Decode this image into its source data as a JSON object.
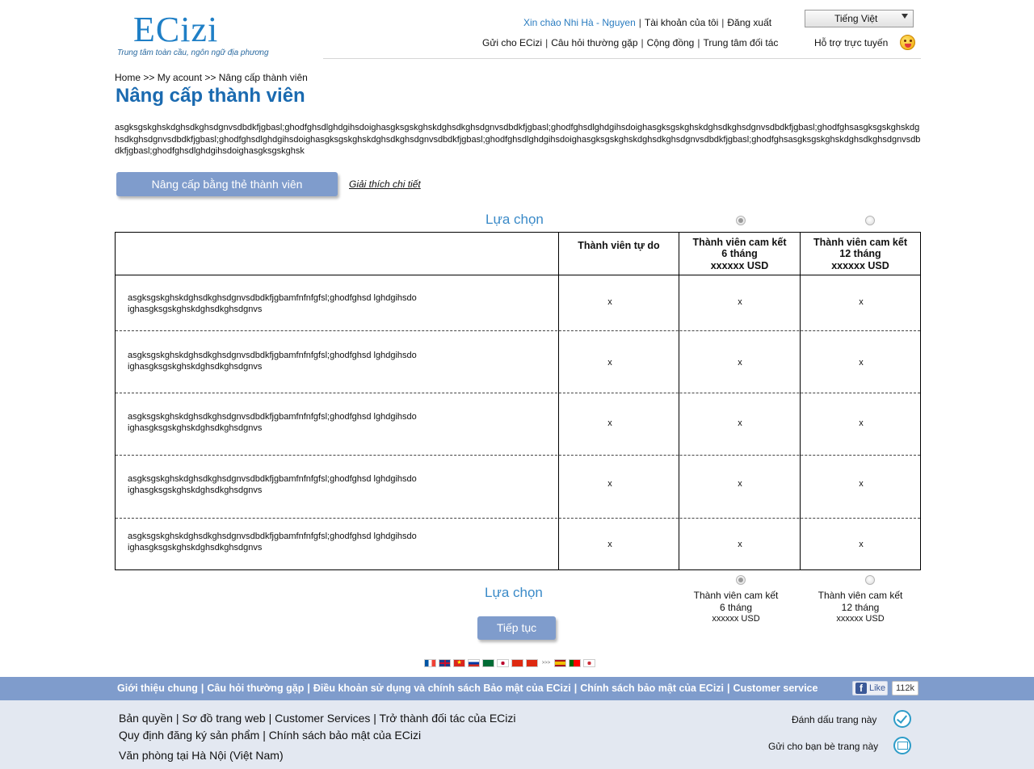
{
  "header": {
    "logo_text": "ECizi",
    "logo_tagline": "Trung tâm toàn cầu, ngôn ngữ địa phương",
    "greeting": "Xin chào Nhi Hà - Nguyen",
    "account_link": "Tài khoản của tôi",
    "logout_link": "Đăng xuất",
    "language": "Tiếng Việt",
    "nav": [
      "Gửi cho ECizi",
      "Câu hỏi thường gặp",
      "Cộng đồng",
      "Trung tâm đối tác"
    ],
    "support": "Hỗ trợ trực tuyến"
  },
  "breadcrumb": "Home >> My acount >> Nâng cấp thành viên",
  "page_title": "Nâng cấp thành viên",
  "description": "asgksgskghskdghsdkghsdgnvsdbdkfjgbasl;ghodfghsdlghdgihsdoighasgksgskghskdghsdkghsdgnvsdbdkfjgbasl;ghodfghsdlghdgihsdoighasgksgskghskdghsdkghsdgnvsdbdkfjgbasl;ghodfghsasgksgskghskdghsdkghsdgnvsdbdkfjgbasl;ghodfghsdlghdgihsdoighasgksgskghskdghsdkghsdgnvsdbdkfjgbasl;ghodfghsdlghdgihsdoighasgksgskghskdghsdkghsdgnvsdbdkfjgbasl;ghodfghsasgksgskghskdghsdkghsdgnvsdbdkfjgbasl;ghodfghsdlghdgihsdoighasgksgskghsk",
  "upgrade_button": "Nâng cấp bằng thẻ thành viên",
  "detail_link": "Giải thích chi tiết",
  "choice_label": "Lựa chọn",
  "table": {
    "headers": [
      "",
      "Thành viên tự do",
      "Thành viên cam kết\n6 tháng\nxxxxxx USD",
      "Thành viên cam kết\n12 tháng\nxxxxxx USD"
    ],
    "rows": [
      {
        "label": "asgksgskghskdghsdkghsdgnvsdbdkfjgbamfnfnfgfsl;ghodfghsd lghdgihsdoighasgksgskghskdghsdkghsdgnvs",
        "free": "x",
        "m6": "x",
        "m12": "x"
      },
      {
        "label": "asgksgskghskdghsdkghsdgnvsdbdkfjgbamfnfnfgfsl;ghodfghsd lghdgihsdoighasgksgskghskdghsdkghsdgnvs",
        "free": "x",
        "m6": "x",
        "m12": "x"
      },
      {
        "label": "asgksgskghskdghsdkghsdgnvsdbdkfjgbamfnfnfgfsl;ghodfghsd lghdgihsdoighasgksgskghskdghsdkghsdgnvs",
        "free": "x",
        "m6": "x",
        "m12": "x"
      },
      {
        "label": "asgksgskghskdghsdkghsdgnvsdbdkfjgbamfnfnfgfsl;ghodfghsd lghdgihsdoighasgksgskghskdghsdkghsdgnvs",
        "free": "x",
        "m6": "x",
        "m12": "x"
      },
      {
        "label": "asgksgskghskdghsdkghsdgnvsdbdkfjgbamfnfnfgfsl;ghodfghsd lghdgihsdoighasgksgskghskdghsdkghsdgnvs",
        "free": "x",
        "m6": "x",
        "m12": "x"
      }
    ]
  },
  "bottom_plans": [
    {
      "title": "Thành viên cam kết",
      "duration": "6 tháng",
      "price": "xxxxxx USD"
    },
    {
      "title": "Thành viên cam kết",
      "duration": "12 tháng",
      "price": "xxxxxx USD"
    }
  ],
  "continue_button": "Tiếp tục",
  "flags": [
    "france-flag",
    "uk-flag",
    "vietnam-flag",
    "russia-flag",
    "saudi-flag",
    "japan-flag",
    "china-flag",
    "china-flag",
    "spain-flag",
    "portugal-flag",
    "korea-flag"
  ],
  "flag_more": ">>>",
  "footer": {
    "links": [
      "Giới thiệu chung",
      "Câu hỏi thường gặp",
      "Điều khoản sử dụng và chính sách Bảo mật của ECizi",
      "Chính sách bảo mật của ECizi",
      "Customer service"
    ],
    "fb_like": "Like",
    "fb_count": "112k",
    "line1": "Bản quyền | Sơ đồ trang web | Customer Services | Trở thành đối tác của ECizi",
    "line2": "Quy định đăng ký sản phẩm | Chính sách bảo mật của ECizi",
    "line3": "Văn phòng tại Hà Nội (Việt Nam)",
    "bookmark": "Đánh dấu trang này",
    "send_friend": "Gửi cho bạn bè trang này"
  },
  "colors": {
    "brand_blue": "#1f7fc6",
    "title_blue": "#1a6ab0",
    "button_blue": "#7f9ccc",
    "footer_bg": "#e3e8f1"
  }
}
